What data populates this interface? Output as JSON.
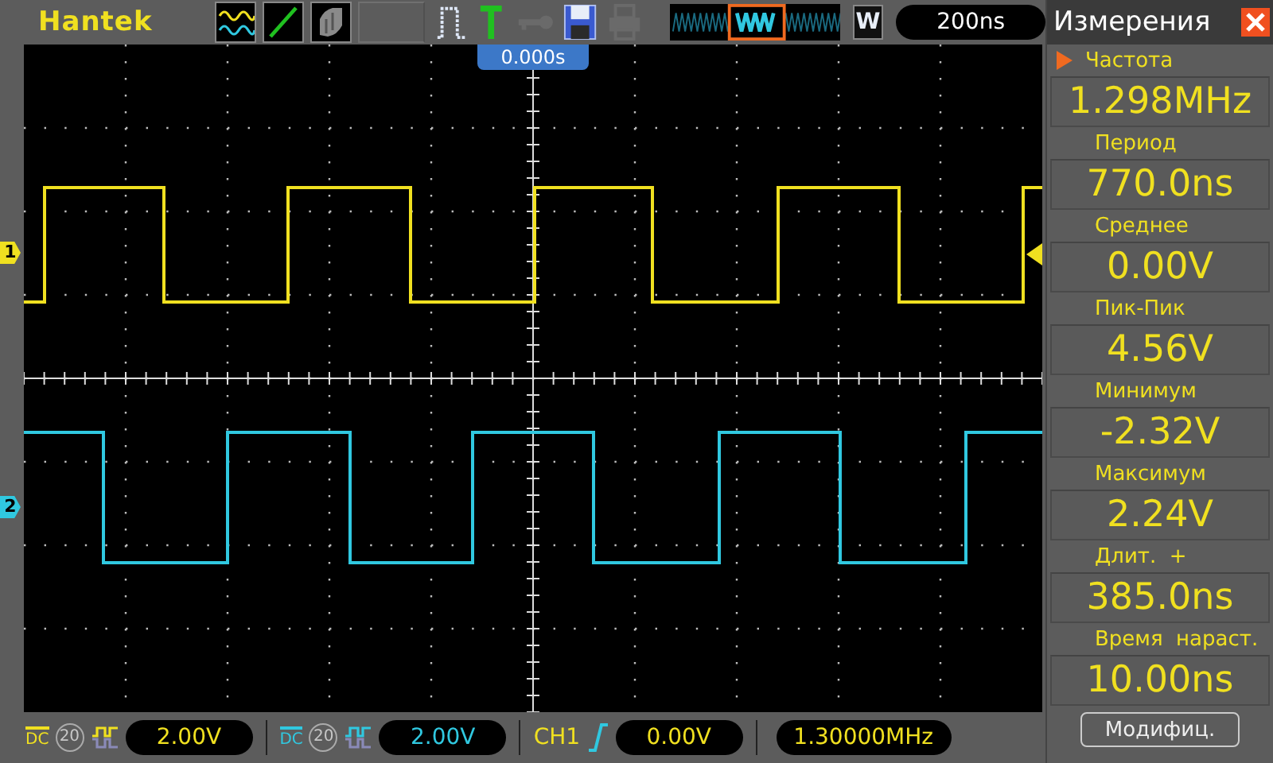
{
  "brand": "Hantek",
  "timebase": "200ns",
  "zoom_label": "W",
  "trigger_position": "0.000s",
  "channels": [
    {
      "marker": "1",
      "color": "#f0e020",
      "coupling": "DC",
      "bw_limit_label": "20",
      "bw_limit_on": false,
      "volts": "2.00V"
    },
    {
      "marker": "2",
      "color": "#30c8e0",
      "coupling": "DC",
      "bw_limit_label": "20",
      "bw_limit_on": false,
      "volts": "2.00V"
    }
  ],
  "trigger": {
    "source": "CH1",
    "level": "0.00V",
    "frequency": "1.30000MHz"
  },
  "panel": {
    "title": "Измерения",
    "measurements": [
      {
        "label": "Частота",
        "value": "1.298MHz",
        "selected": true
      },
      {
        "label": "Период",
        "value": "770.0ns",
        "selected": false
      },
      {
        "label": "Среднее",
        "value": "0.00V",
        "selected": false
      },
      {
        "label": "Пик-Пик",
        "value": "4.56V",
        "selected": false
      },
      {
        "label": "Минимум",
        "value": "-2.32V",
        "selected": false
      },
      {
        "label": "Максимум",
        "value": "2.24V",
        "selected": false
      },
      {
        "label": "Длит.  +",
        "value": "385.0ns",
        "selected": false
      },
      {
        "label": "Время  нараст.",
        "value": "10.00ns",
        "selected": false
      }
    ],
    "button": "Модифиц."
  }
}
